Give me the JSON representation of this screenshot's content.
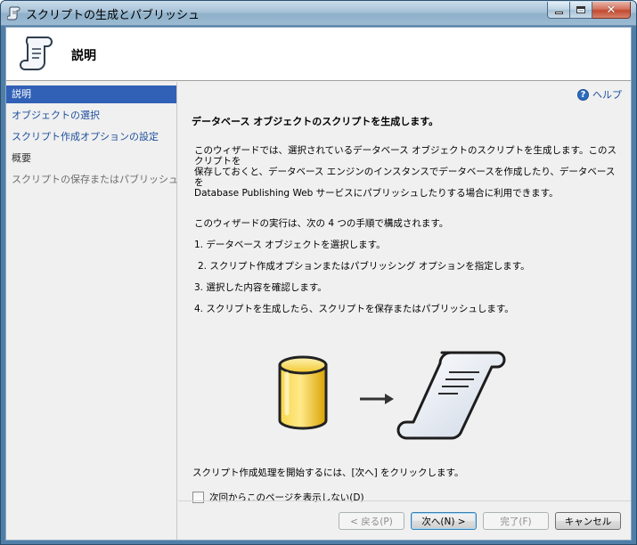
{
  "window": {
    "title": "スクリプトの生成とパブリッシュ",
    "close_glyph": "✕"
  },
  "header": {
    "title": "説明"
  },
  "sidebar": {
    "items": [
      {
        "label": "説明",
        "state": "selected"
      },
      {
        "label": "オブジェクトの選択",
        "state": "link"
      },
      {
        "label": "スクリプト作成オプションの設定",
        "state": "link"
      },
      {
        "label": "概要",
        "state": "plain"
      },
      {
        "label": "スクリプトの保存またはパブリッシュ",
        "state": "disabled"
      }
    ]
  },
  "content": {
    "help_label": "ヘルプ",
    "help_glyph": "?",
    "title": "データベース オブジェクトのスクリプトを生成します。",
    "intro_lines": [
      "このウィザードでは、選択されているデータベース オブジェクトのスクリプトを生成します。このスクリプトを",
      "保存しておくと、データベース エンジンのインスタンスでデータベースを作成したり、データベースを",
      "Database Publishing Web サービスにパブリッシュしたりする場合に利用できます。"
    ],
    "steps_lead": "このウィザードの実行は、次の 4 つの手順で構成されます。",
    "steps": [
      "1. データベース オブジェクトを選択します。",
      "2. スクリプト作成オプションまたはパブリッシング オプションを指定します。",
      "3. 選択した内容を確認します。",
      "4. スクリプトを生成したら、スクリプトを保存またはパブリッシュします。"
    ],
    "start_text": "スクリプト作成処理を開始するには、[次へ] をクリックします。",
    "checkbox_label": "次回からこのページを表示しない(D)",
    "checkbox_checked": false
  },
  "buttons": {
    "back": "< 戻る(P)",
    "next": "次へ(N) >",
    "finish": "完了(F)",
    "cancel": "キャンセル"
  },
  "colors": {
    "selected_nav_bg": "#3161b6",
    "link": "#1d4f9c",
    "cylinder_yellow": "#f4c41a"
  }
}
